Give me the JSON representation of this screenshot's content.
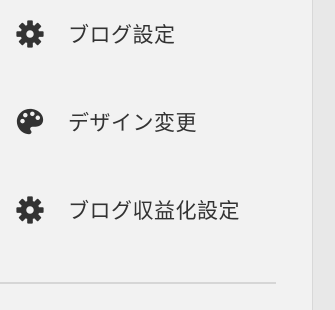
{
  "menu": {
    "items": [
      {
        "label": "ブログ設定",
        "icon": "gear-icon"
      },
      {
        "label": "デザイン変更",
        "icon": "palette-icon"
      },
      {
        "label": "ブログ収益化設定",
        "icon": "gear-icon"
      }
    ]
  },
  "colors": {
    "background": "#f2f2f2",
    "text": "#333333",
    "icon": "#333333",
    "divider": "#d6d6d6"
  }
}
